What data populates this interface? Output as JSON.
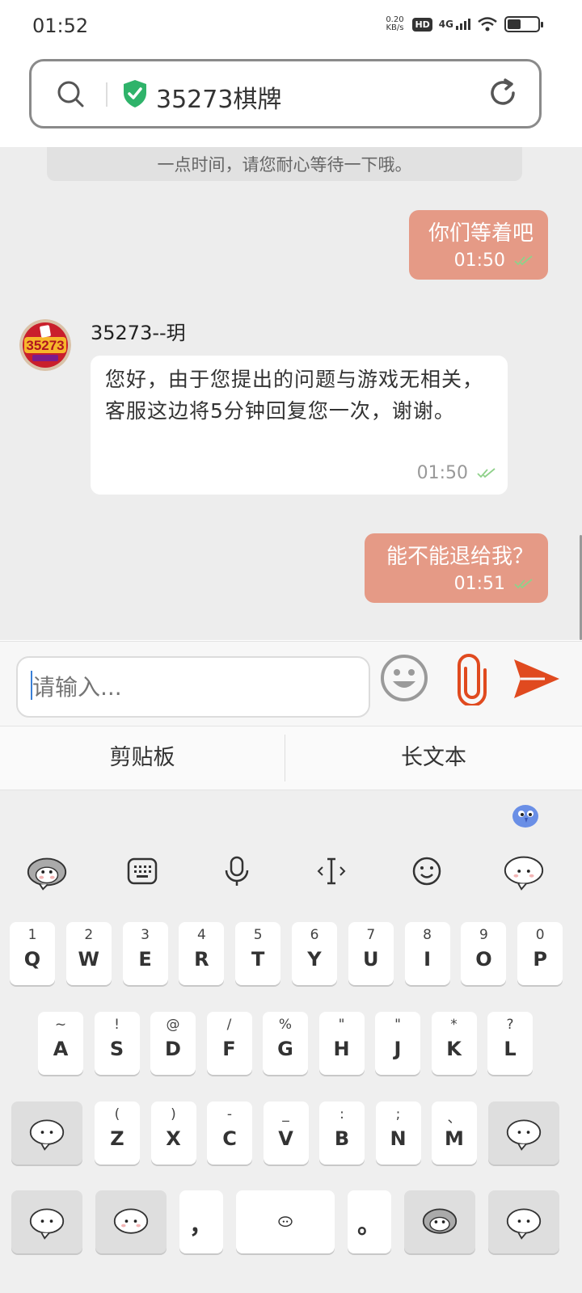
{
  "status_bar": {
    "time": "01:52",
    "net_speed_value": "0.20",
    "net_speed_unit": "KB/s",
    "hd_badge": "HD",
    "network": "4G"
  },
  "url_bar": {
    "site_title": "35273棋牌"
  },
  "chat": {
    "system_notice": "一点时间，请您耐心等待一下哦。",
    "messages": [
      {
        "direction": "out",
        "text": "你们等着吧",
        "time": "01:50"
      },
      {
        "direction": "in",
        "sender": "35273--玥",
        "text": "您好，由于您提出的问题与游戏无相关，客服这边将5分钟回复您一次，谢谢。",
        "time": "01:50"
      },
      {
        "direction": "out",
        "text": "能不能退给我？",
        "time": "01:51"
      }
    ]
  },
  "composer": {
    "placeholder": "请输入..."
  },
  "keyboard_toolbar": {
    "clipboard_label": "剪贴板",
    "long_text_label": "长文本"
  },
  "keyboard": {
    "row1": [
      {
        "sub": "1",
        "main": "Q"
      },
      {
        "sub": "2",
        "main": "W"
      },
      {
        "sub": "3",
        "main": "E"
      },
      {
        "sub": "4",
        "main": "R"
      },
      {
        "sub": "5",
        "main": "T"
      },
      {
        "sub": "6",
        "main": "Y"
      },
      {
        "sub": "7",
        "main": "U"
      },
      {
        "sub": "8",
        "main": "I"
      },
      {
        "sub": "9",
        "main": "O"
      },
      {
        "sub": "0",
        "main": "P"
      }
    ],
    "row2": [
      {
        "sub": "~",
        "main": "A"
      },
      {
        "sub": "!",
        "main": "S"
      },
      {
        "sub": "@",
        "main": "D"
      },
      {
        "sub": "/",
        "main": "F"
      },
      {
        "sub": "%",
        "main": "G"
      },
      {
        "sub": "\"",
        "main": "H"
      },
      {
        "sub": "\"",
        "main": "J"
      },
      {
        "sub": "*",
        "main": "K"
      },
      {
        "sub": "?",
        "main": "L"
      }
    ],
    "row3": [
      {
        "sub": "(",
        "main": "Z"
      },
      {
        "sub": ")",
        "main": "X"
      },
      {
        "sub": "-",
        "main": "C"
      },
      {
        "sub": "_",
        "main": "V"
      },
      {
        "sub": ":",
        "main": "B"
      },
      {
        "sub": ";",
        "main": "N"
      },
      {
        "sub": "、",
        "main": "M"
      }
    ],
    "comma": "，",
    "period": "。"
  },
  "colors": {
    "outgoing_bubble": "#e59a86",
    "send_accent": "#e04a1f",
    "secure_green": "#2fb36a"
  }
}
